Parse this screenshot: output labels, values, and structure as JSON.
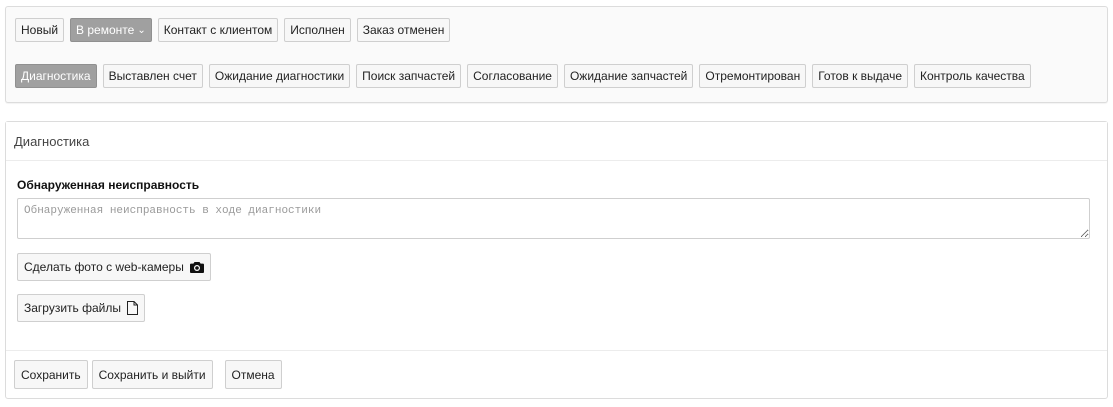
{
  "status_row_1": [
    {
      "label": "Новый",
      "active": false
    },
    {
      "label": "В ремонте",
      "active": true,
      "has_dropdown": true
    },
    {
      "label": "Контакт с клиентом",
      "active": false
    },
    {
      "label": "Исполнен",
      "active": false
    },
    {
      "label": "Заказ отменен",
      "active": false
    }
  ],
  "status_row_2": [
    {
      "label": "Диагностика",
      "active": true
    },
    {
      "label": "Выставлен счет",
      "active": false
    },
    {
      "label": "Ожидание диагностики",
      "active": false
    },
    {
      "label": "Поиск запчастей",
      "active": false
    },
    {
      "label": "Согласование",
      "active": false
    },
    {
      "label": "Ожидание запчастей",
      "active": false
    },
    {
      "label": "Отремонтирован",
      "active": false
    },
    {
      "label": "Готов к выдаче",
      "active": false
    },
    {
      "label": "Контроль качества",
      "active": false
    }
  ],
  "form": {
    "title": "Диагностика",
    "field_label": "Обнаруженная неисправность",
    "field_value": "",
    "field_placeholder": "Обнаруженная неисправность в ходе диагностики",
    "camera_button": "Сделать фото с web-камеры",
    "camera_icon": "camera-icon",
    "upload_button": "Загрузить файлы",
    "upload_icon": "file-icon"
  },
  "footer": {
    "save": "Сохранить",
    "save_exit": "Сохранить и выйти",
    "cancel": "Отмена"
  },
  "colors": {
    "active_button_bg": "#a0a0a0",
    "button_bg": "#f7f7f7",
    "border": "#cfcfcf"
  }
}
